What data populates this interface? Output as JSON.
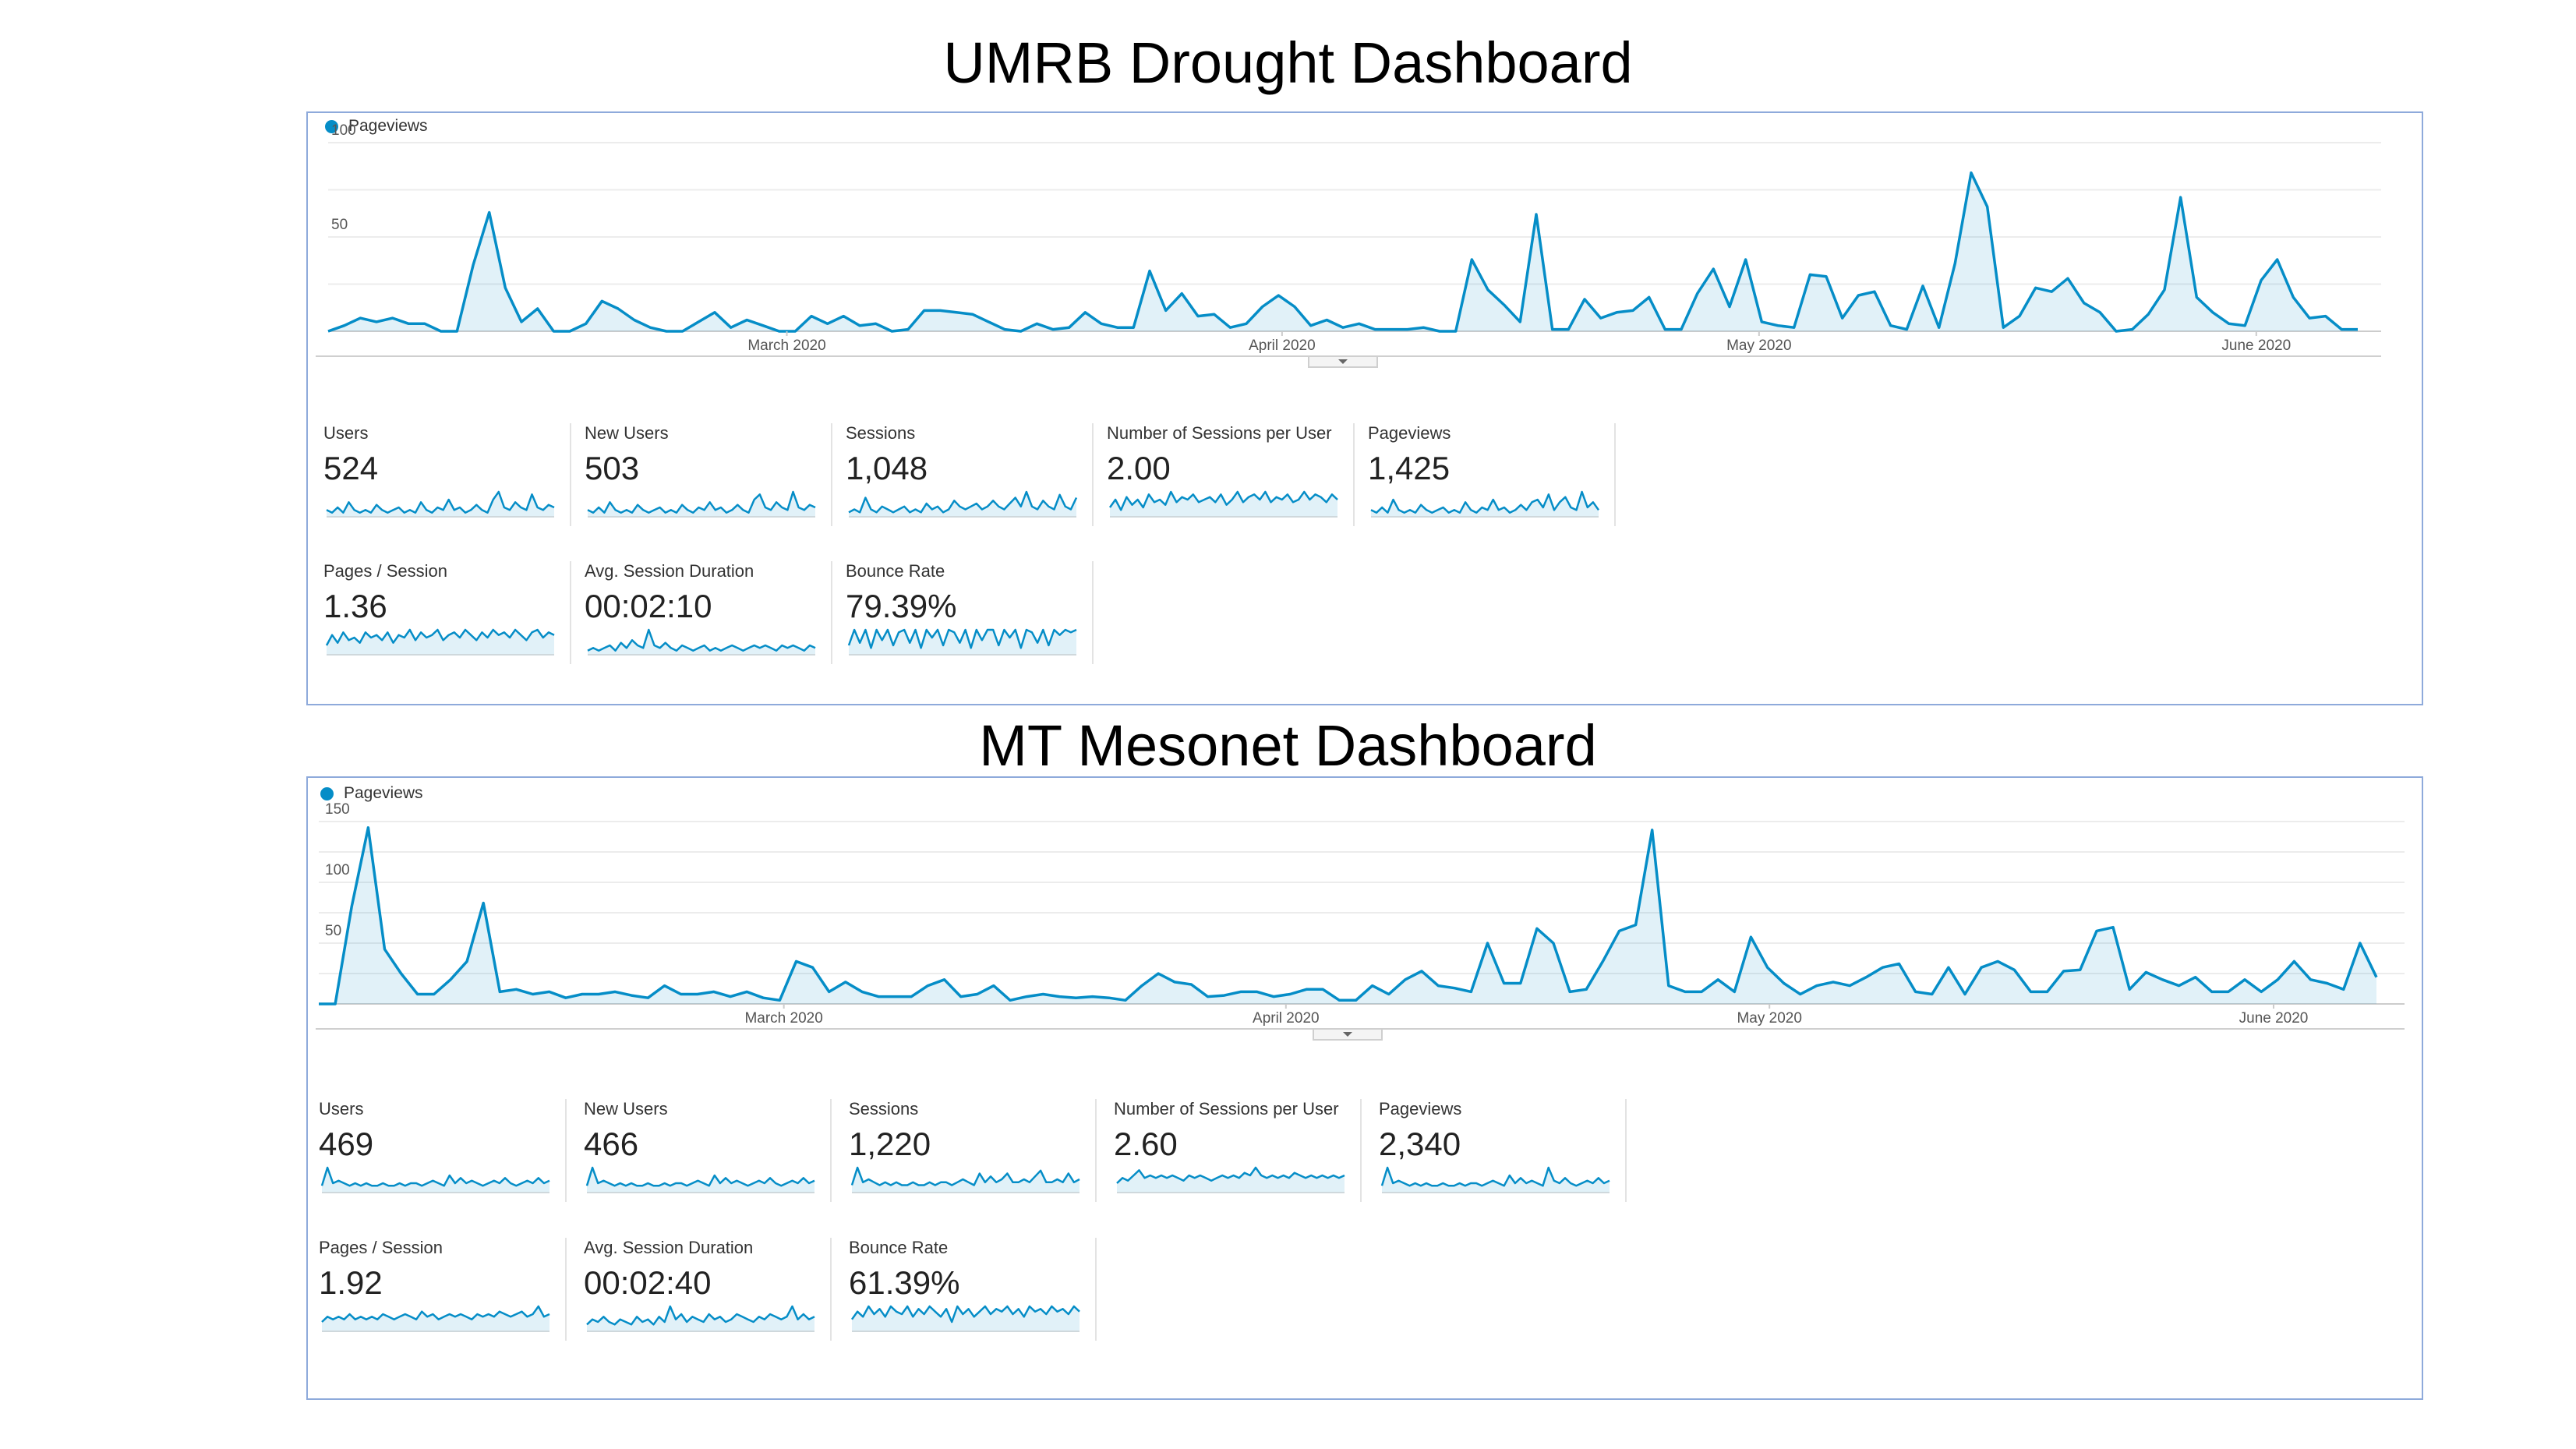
{
  "dashboards": [
    {
      "title": "UMRB Drought Dashboard",
      "chart_data": {
        "type": "area",
        "series": [
          {
            "name": "Pageviews",
            "values": [
              0,
              3,
              7,
              5,
              7,
              4,
              4,
              0,
              0,
              35,
              63,
              23,
              5,
              12,
              0,
              0,
              4,
              16,
              12,
              6,
              2,
              0,
              0,
              5,
              10,
              2,
              6,
              3,
              0,
              0,
              8,
              4,
              8,
              3,
              4,
              0,
              1,
              11,
              11,
              10,
              9,
              5,
              1,
              0,
              4,
              1,
              2,
              10,
              4,
              2,
              2,
              32,
              11,
              20,
              8,
              9,
              2,
              4,
              13,
              19,
              13,
              3,
              6,
              2,
              4,
              1,
              1,
              1,
              2,
              0,
              0,
              38,
              22,
              14,
              5,
              62,
              1,
              1,
              17,
              7,
              10,
              11,
              18,
              1,
              1,
              20,
              33,
              13,
              38,
              5,
              3,
              2,
              30,
              29,
              7,
              19,
              21,
              3,
              1,
              24,
              2,
              36,
              84,
              66,
              2,
              8,
              23,
              21,
              28,
              15,
              10,
              0,
              1,
              9,
              22,
              71,
              18,
              10,
              4,
              3,
              27,
              38,
              18,
              7,
              8,
              1,
              1
            ]
          }
        ],
        "x_ticks": [
          "March 2020",
          "April 2020",
          "May 2020",
          "June 2020"
        ],
        "y_ticks": [
          "100",
          "50"
        ],
        "ylim": [
          0,
          100
        ],
        "legend_position": "top-left",
        "grid": true,
        "accent": "#058dc7"
      },
      "metrics": [
        {
          "label": "Users",
          "value": "524",
          "spark": [
            2,
            1,
            3,
            1,
            5,
            2,
            1,
            2,
            1,
            4,
            2,
            1,
            2,
            3,
            1,
            2,
            1,
            5,
            2,
            1,
            3,
            2,
            6,
            2,
            3,
            1,
            2,
            4,
            2,
            1,
            6,
            9,
            3,
            2,
            5,
            3,
            2,
            8,
            3,
            2,
            4,
            3
          ]
        },
        {
          "label": "New Users",
          "value": "503",
          "spark": [
            2,
            1,
            3,
            1,
            5,
            2,
            1,
            2,
            1,
            4,
            2,
            1,
            2,
            3,
            1,
            2,
            1,
            4,
            2,
            1,
            3,
            2,
            5,
            2,
            3,
            1,
            2,
            4,
            2,
            1,
            6,
            8,
            3,
            2,
            5,
            3,
            2,
            9,
            3,
            2,
            4,
            3
          ]
        },
        {
          "label": "Sessions",
          "value": "1,048",
          "spark": [
            1,
            2,
            1,
            6,
            2,
            1,
            3,
            2,
            1,
            2,
            3,
            1,
            2,
            1,
            4,
            2,
            3,
            1,
            2,
            5,
            3,
            2,
            3,
            4,
            2,
            3,
            5,
            3,
            2,
            4,
            6,
            3,
            8,
            3,
            2,
            5,
            3,
            2,
            7,
            3,
            2,
            6
          ]
        },
        {
          "label": "Number of Sessions per User",
          "value": "2.00",
          "spark": [
            3,
            6,
            2,
            7,
            4,
            6,
            3,
            8,
            5,
            6,
            4,
            9,
            5,
            7,
            6,
            8,
            5,
            6,
            7,
            5,
            8,
            4,
            6,
            9,
            5,
            7,
            8,
            6,
            9,
            5,
            7,
            6,
            8,
            5,
            6,
            9,
            6,
            8,
            7,
            5,
            8,
            6
          ]
        },
        {
          "label": "Pageviews",
          "value": "1,425",
          "spark": [
            2,
            1,
            3,
            1,
            6,
            2,
            1,
            2,
            1,
            4,
            2,
            1,
            2,
            3,
            1,
            2,
            1,
            5,
            2,
            1,
            3,
            2,
            6,
            2,
            3,
            1,
            2,
            4,
            2,
            5,
            6,
            3,
            8,
            2,
            5,
            7,
            3,
            2,
            9,
            3,
            5,
            2
          ]
        },
        {
          "label": "Pages / Session",
          "value": "1.36",
          "spark": [
            3,
            7,
            4,
            8,
            5,
            6,
            4,
            8,
            6,
            7,
            5,
            8,
            4,
            7,
            6,
            9,
            5,
            8,
            6,
            7,
            9,
            5,
            7,
            8,
            6,
            9,
            7,
            5,
            8,
            6,
            9,
            7,
            8,
            6,
            9,
            7,
            5,
            8,
            9,
            6,
            8,
            7
          ]
        },
        {
          "label": "Avg. Session Duration",
          "value": "00:02:10",
          "spark": [
            1,
            2,
            1,
            2,
            3,
            1,
            4,
            2,
            5,
            3,
            2,
            9,
            3,
            2,
            4,
            2,
            1,
            3,
            2,
            1,
            2,
            3,
            1,
            2,
            1,
            2,
            3,
            2,
            1,
            2,
            3,
            2,
            3,
            2,
            1,
            3,
            2,
            3,
            2,
            1,
            3,
            2
          ]
        },
        {
          "label": "Bounce Rate",
          "value": "79.39%",
          "spark": [
            3,
            9,
            4,
            9,
            2,
            9,
            5,
            9,
            3,
            8,
            9,
            4,
            9,
            2,
            9,
            6,
            9,
            3,
            9,
            8,
            4,
            9,
            2,
            9,
            5,
            9,
            9,
            3,
            9,
            6,
            9,
            2,
            9,
            8,
            4,
            9,
            3,
            9,
            7,
            9,
            8,
            9
          ]
        }
      ]
    },
    {
      "title": "MT Mesonet Dashboard",
      "chart_data": {
        "type": "area",
        "series": [
          {
            "name": "Pageviews",
            "values": [
              0,
              0,
              80,
              145,
              45,
              25,
              8,
              8,
              20,
              35,
              83,
              10,
              12,
              8,
              10,
              5,
              8,
              8,
              10,
              7,
              5,
              15,
              8,
              8,
              10,
              6,
              10,
              5,
              3,
              35,
              30,
              10,
              18,
              10,
              6,
              6,
              6,
              15,
              20,
              6,
              8,
              15,
              3,
              6,
              8,
              6,
              5,
              6,
              5,
              3,
              15,
              25,
              18,
              16,
              6,
              7,
              10,
              10,
              6,
              8,
              12,
              12,
              3,
              3,
              15,
              8,
              20,
              27,
              15,
              13,
              10,
              50,
              17,
              17,
              62,
              50,
              10,
              12,
              35,
              60,
              65,
              143,
              15,
              10,
              10,
              20,
              10,
              55,
              30,
              17,
              8,
              15,
              18,
              15,
              22,
              30,
              33,
              10,
              8,
              30,
              8,
              30,
              35,
              28,
              10,
              10,
              27,
              28,
              60,
              63,
              12,
              26,
              20,
              15,
              22,
              10,
              10,
              20,
              10,
              20,
              35,
              20,
              17,
              12,
              50,
              22
            ]
          }
        ],
        "x_ticks": [
          "March 2020",
          "April 2020",
          "May 2020",
          "June 2020"
        ],
        "y_ticks": [
          "150",
          "100",
          "50"
        ],
        "ylim": [
          0,
          150
        ],
        "legend_position": "top-left",
        "grid": true,
        "accent": "#058dc7"
      },
      "metrics": [
        {
          "label": "Users",
          "value": "469",
          "spark": [
            2,
            9,
            3,
            4,
            3,
            2,
            3,
            2,
            3,
            2,
            2,
            3,
            2,
            2,
            3,
            2,
            3,
            3,
            2,
            3,
            4,
            3,
            2,
            6,
            3,
            5,
            3,
            4,
            3,
            2,
            3,
            4,
            3,
            5,
            3,
            2,
            3,
            4,
            3,
            5,
            3,
            4
          ]
        },
        {
          "label": "New Users",
          "value": "466",
          "spark": [
            2,
            9,
            3,
            4,
            3,
            2,
            3,
            2,
            3,
            2,
            2,
            3,
            2,
            2,
            3,
            2,
            3,
            3,
            2,
            3,
            4,
            3,
            2,
            6,
            3,
            5,
            3,
            4,
            3,
            2,
            3,
            4,
            3,
            5,
            3,
            2,
            3,
            4,
            3,
            5,
            3,
            4
          ]
        },
        {
          "label": "Sessions",
          "value": "1,220",
          "spark": [
            2,
            8,
            3,
            4,
            3,
            2,
            3,
            2,
            3,
            2,
            2,
            3,
            2,
            2,
            3,
            2,
            3,
            3,
            2,
            3,
            4,
            3,
            2,
            6,
            3,
            5,
            3,
            4,
            6,
            3,
            3,
            4,
            3,
            5,
            7,
            3,
            3,
            4,
            3,
            6,
            3,
            4
          ]
        },
        {
          "label": "Number of Sessions per User",
          "value": "2.60",
          "spark": [
            3,
            5,
            4,
            6,
            8,
            5,
            6,
            5,
            6,
            5,
            6,
            5,
            4,
            6,
            5,
            6,
            5,
            4,
            5,
            6,
            5,
            6,
            5,
            7,
            6,
            9,
            6,
            5,
            6,
            5,
            6,
            5,
            7,
            6,
            5,
            6,
            5,
            6,
            5,
            6,
            5,
            6
          ]
        },
        {
          "label": "Pageviews",
          "value": "2,340",
          "spark": [
            2,
            9,
            3,
            4,
            3,
            2,
            3,
            2,
            3,
            2,
            2,
            3,
            2,
            2,
            3,
            2,
            3,
            3,
            2,
            3,
            4,
            3,
            2,
            6,
            3,
            5,
            3,
            4,
            3,
            2,
            9,
            4,
            3,
            5,
            3,
            2,
            3,
            4,
            3,
            5,
            3,
            4
          ]
        },
        {
          "label": "Pages / Session",
          "value": "1.92",
          "spark": [
            3,
            5,
            4,
            5,
            4,
            6,
            4,
            5,
            4,
            5,
            4,
            6,
            5,
            4,
            5,
            6,
            5,
            4,
            7,
            5,
            6,
            4,
            5,
            6,
            5,
            6,
            5,
            4,
            6,
            5,
            6,
            5,
            7,
            6,
            5,
            6,
            7,
            5,
            6,
            9,
            5,
            6
          ]
        },
        {
          "label": "Avg. Session Duration",
          "value": "00:02:40",
          "spark": [
            2,
            4,
            3,
            5,
            3,
            2,
            4,
            3,
            2,
            5,
            3,
            4,
            2,
            5,
            3,
            9,
            4,
            6,
            3,
            5,
            4,
            3,
            6,
            4,
            5,
            3,
            4,
            6,
            5,
            4,
            3,
            5,
            4,
            6,
            5,
            4,
            5,
            9,
            4,
            6,
            4,
            5
          ]
        },
        {
          "label": "Bounce Rate",
          "value": "61.39%",
          "spark": [
            4,
            7,
            5,
            9,
            6,
            8,
            5,
            9,
            7,
            6,
            9,
            5,
            8,
            6,
            9,
            7,
            5,
            8,
            3,
            9,
            6,
            8,
            5,
            7,
            9,
            6,
            8,
            7,
            9,
            6,
            8,
            5,
            9,
            7,
            8,
            6,
            9,
            7,
            8,
            6,
            9,
            7
          ]
        }
      ]
    }
  ]
}
